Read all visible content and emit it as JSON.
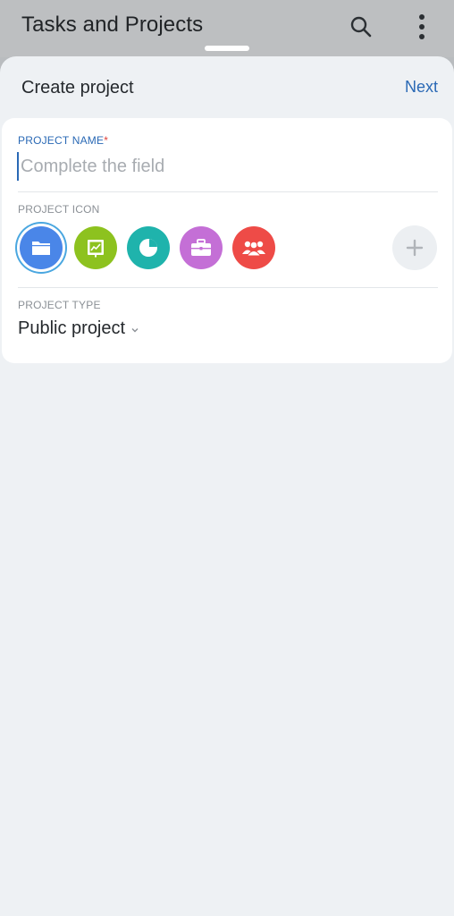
{
  "appbar": {
    "title": "Tasks and Projects",
    "search_icon": "search-icon",
    "more_icon": "more-vert-icon"
  },
  "sheet": {
    "title": "Create project",
    "next_label": "Next"
  },
  "form": {
    "name_label": "PROJECT NAME",
    "name_required": "*",
    "name_placeholder": "Complete the field",
    "name_value": "",
    "icon_label": "PROJECT ICON",
    "icons": [
      {
        "name": "folder-icon",
        "color": "#4a86e8",
        "selected": true
      },
      {
        "name": "chart-board-icon",
        "color": "#8dc21f",
        "selected": false
      },
      {
        "name": "pie-chart-icon",
        "color": "#1fb3ac",
        "selected": false
      },
      {
        "name": "briefcase-icon",
        "color": "#c46fd6",
        "selected": false
      },
      {
        "name": "people-group-icon",
        "color": "#ee4b47",
        "selected": false
      }
    ],
    "add_icon": "plus-icon",
    "type_label": "PROJECT TYPE",
    "type_value": "Public project"
  },
  "colors": {
    "accent": "#2a69b5",
    "required": "#e0423a",
    "sheet_bg": "#eef1f4"
  }
}
